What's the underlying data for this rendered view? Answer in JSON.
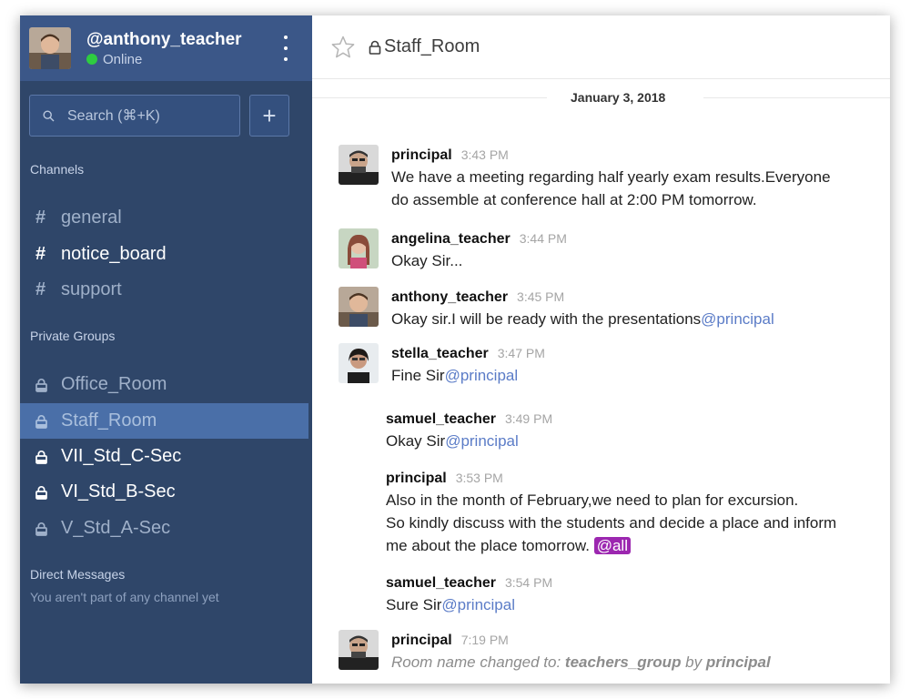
{
  "user": {
    "handle": "@anthony_teacher",
    "status": "Online"
  },
  "search": {
    "placeholder": "Search (⌘+K)"
  },
  "create_label": "+",
  "sections": {
    "channels": "Channels",
    "private_groups": "Private Groups",
    "direct_messages": "Direct Messages",
    "direct_messages_empty": "You aren't part of any channel yet"
  },
  "channels": [
    {
      "name": "general",
      "state": "dim"
    },
    {
      "name": "notice_board",
      "state": "bright"
    },
    {
      "name": "support",
      "state": "dim"
    }
  ],
  "groups": [
    {
      "name": "Office_Room",
      "state": "dim"
    },
    {
      "name": "Staff_Room",
      "state": "active"
    },
    {
      "name": "VII_Std_C-Sec",
      "state": "bright"
    },
    {
      "name": "VI_Std_B-Sec",
      "state": "bright"
    },
    {
      "name": "V_Std_A-Sec",
      "state": "dim"
    }
  ],
  "room": {
    "title": "Staff_Room"
  },
  "date_separators": [
    "January 3, 2018"
  ],
  "messages": [
    {
      "user": "principal",
      "time": "3:43 PM",
      "lines": [
        "We have a meeting regarding half yearly exam results.Everyone",
        "do assemble at conference hall at 2:00 PM tomorrow."
      ]
    },
    {
      "user": "angelina_teacher",
      "time": "3:44 PM",
      "text": "Okay Sir..."
    },
    {
      "user": "anthony_teacher",
      "time": "3:45 PM",
      "text": "Okay sir.I will be ready with the presentations",
      "mention": "@principal"
    },
    {
      "user": "stella_teacher",
      "time": "3:47 PM",
      "text": "Fine Sir",
      "mention": "@principal"
    },
    {
      "user": "samuel_teacher",
      "time": "3:49 PM",
      "text": "Okay Sir",
      "mention": "@principal"
    },
    {
      "user": "principal",
      "time": "3:53 PM",
      "lines": [
        "Also in the month of February,we need to plan for excursion.",
        "So kindly discuss with the students and decide a place and inform",
        "me about the place tomorrow."
      ],
      "mention": "@all"
    },
    {
      "user": "samuel_teacher",
      "time": "3:54 PM",
      "text": "Sure Sir",
      "mention": "@principal"
    },
    {
      "user": "principal",
      "time": "7:19 PM",
      "system": {
        "prefix": "Room name changed to: ",
        "room": "teachers_group",
        "by": " by ",
        "actor": "principal"
      }
    }
  ],
  "colors": {
    "sidebar": "#2f4669",
    "sidebar_header": "#3b5788",
    "active_item": "#4a6fa8",
    "mention": "#5b7cc7",
    "mention_all": "#9c27b0",
    "online": "#2ecc40"
  }
}
